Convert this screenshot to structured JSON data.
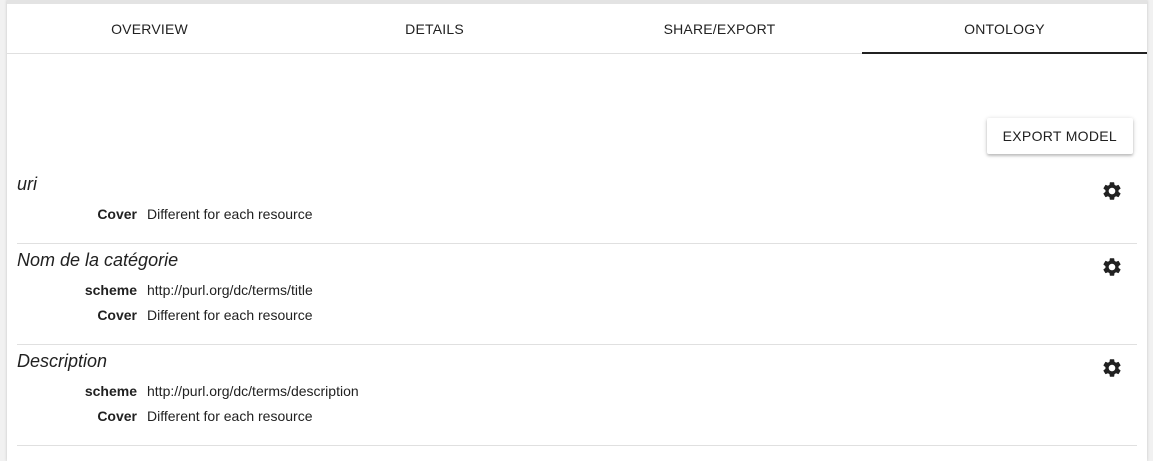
{
  "tabs": [
    {
      "label": "OVERVIEW"
    },
    {
      "label": "DETAILS"
    },
    {
      "label": "SHARE/EXPORT"
    },
    {
      "label": "ONTOLOGY"
    }
  ],
  "active_tab": "ONTOLOGY",
  "toolbar": {
    "export_label": "EXPORT MODEL"
  },
  "fields": [
    {
      "name": "uri",
      "props": [
        {
          "key": "Cover",
          "value": "Different for each resource"
        }
      ]
    },
    {
      "name": "Nom de la catégorie",
      "props": [
        {
          "key": "scheme",
          "value": "http://purl.org/dc/terms/title"
        },
        {
          "key": "Cover",
          "value": "Different for each resource"
        }
      ]
    },
    {
      "name": "Description",
      "props": [
        {
          "key": "scheme",
          "value": "http://purl.org/dc/terms/description"
        },
        {
          "key": "Cover",
          "value": "Different for each resource"
        }
      ]
    }
  ],
  "icons": {
    "settings": "gear-icon"
  }
}
